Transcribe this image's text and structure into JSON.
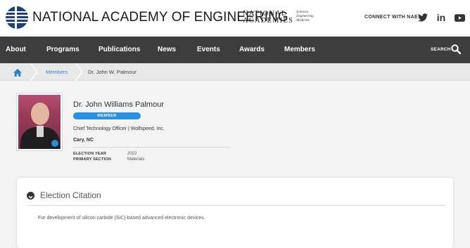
{
  "header": {
    "org_title": "NATIONAL ACADEMY OF ENGINEERING",
    "partner_line1": "NATIONAL",
    "partner_line2": "ACADEMIES",
    "partner_sub": [
      "Sciences",
      "Engineering",
      "Medicine"
    ],
    "connect_label": "CONNECT WITH NAE",
    "social": {
      "twitter": "twitter-icon",
      "linkedin_text": "in",
      "youtube": "youtube-icon"
    }
  },
  "nav": {
    "items": [
      "About",
      "Programs",
      "Publications",
      "News",
      "Events",
      "Awards",
      "Members"
    ],
    "search_label": "SEARCH"
  },
  "breadcrumb": {
    "home_icon": "home-icon",
    "items": [
      "Members",
      "Dr. John W. Palmour"
    ]
  },
  "profile": {
    "name": "Dr. John Williams Palmour",
    "badge": "MEMBER",
    "role": "Chief Technology Officer | Wolfspeed, Inc.",
    "location": "Cary, NC",
    "meta": [
      {
        "label": "ELECTION YEAR",
        "value": "2022"
      },
      {
        "label": "PRIMARY SECTION",
        "value": "Materials"
      }
    ]
  },
  "citation": {
    "title": "Election Citation",
    "text": "For development of silicon carbide (SiC)-based advanced electronic devices."
  },
  "colors": {
    "nav_bg": "#3d3d3d",
    "accent_blue": "#2a8fe0",
    "link_blue": "#3a86c8",
    "logo_navy": "#1f3f7a"
  }
}
